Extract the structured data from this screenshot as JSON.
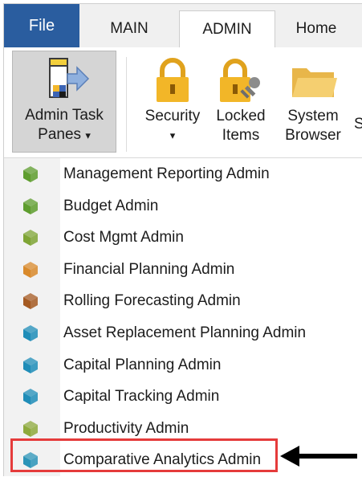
{
  "tabs": {
    "file": "File",
    "main": "MAIN",
    "admin": "ADMIN",
    "home": "Home"
  },
  "ribbon": {
    "admin_task_panes": {
      "line1": "Admin Task",
      "line2": "Panes",
      "caret": "▾",
      "icon": "task-panes-icon"
    },
    "security": {
      "line1": "Security",
      "caret": "▾",
      "icon": "lock-icon"
    },
    "locked_items": {
      "line1": "Locked",
      "line2": "Items",
      "icon": "lock-key-icon"
    },
    "system_browser": {
      "line1": "System",
      "line2": "Browser",
      "icon": "folder-icon"
    },
    "overflow_label": "S"
  },
  "menu": {
    "items": [
      {
        "label": "Management Reporting Admin",
        "color": "#5e9d2e"
      },
      {
        "label": "Budget Admin",
        "color": "#5e9d2e"
      },
      {
        "label": "Cost Mgmt Admin",
        "color": "#7fa535"
      },
      {
        "label": "Financial Planning Admin",
        "color": "#d98a2b"
      },
      {
        "label": "Rolling Forecasting Admin",
        "color": "#a55a22"
      },
      {
        "label": "Asset Replacement Planning Admin",
        "color": "#1f8db8"
      },
      {
        "label": "Capital Planning Admin",
        "color": "#1f8db8"
      },
      {
        "label": "Capital Tracking Admin",
        "color": "#1f8db8"
      },
      {
        "label": "Productivity Admin",
        "color": "#8eaa3c"
      },
      {
        "label": "Comparative Analytics Admin",
        "color": "#2b94b8"
      }
    ],
    "highlight_index": 4,
    "highlight_color": "#e53b3b"
  }
}
